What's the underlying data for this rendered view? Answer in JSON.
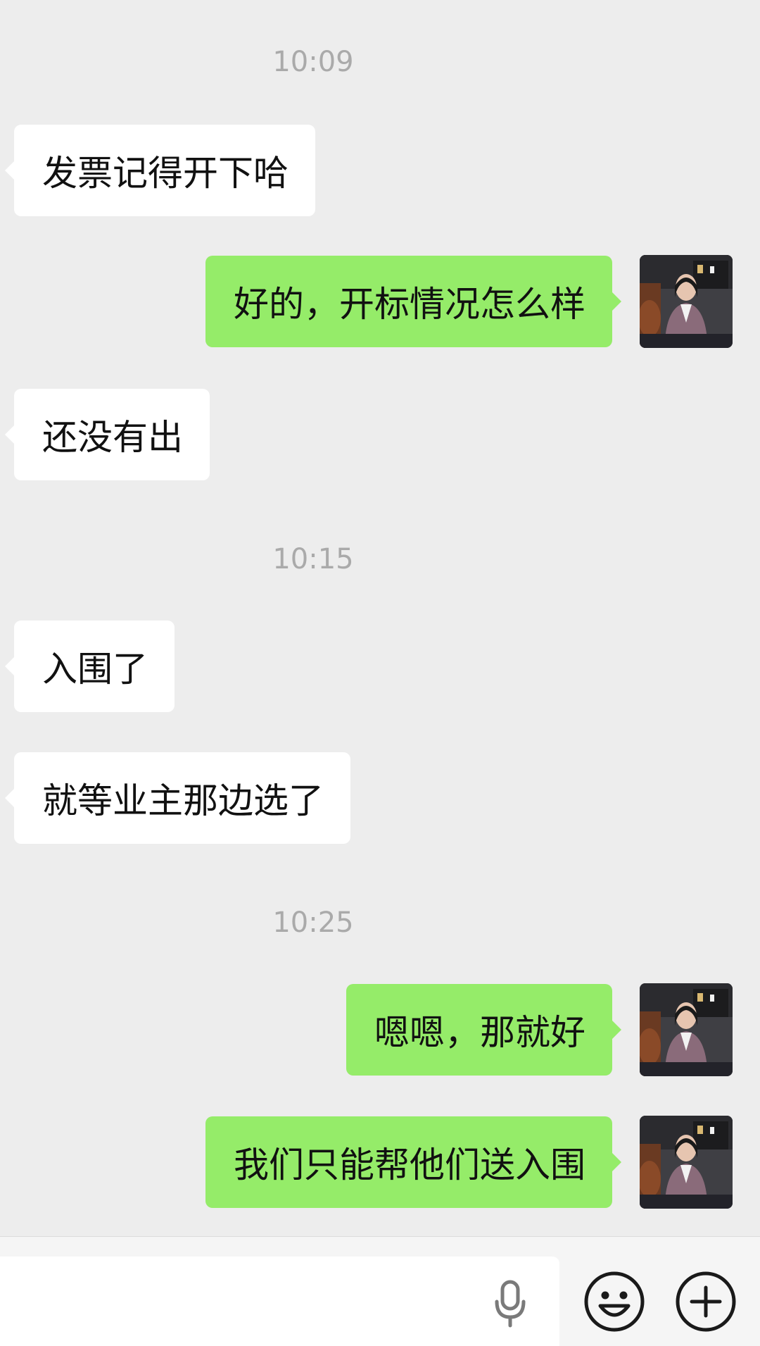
{
  "chat": {
    "items": [
      {
        "type": "time",
        "text": "10:09"
      },
      {
        "type": "in",
        "text": "发票记得开下哈"
      },
      {
        "type": "out",
        "text": "好的，开标情况怎么样"
      },
      {
        "type": "in",
        "text": "还没有出"
      },
      {
        "type": "time",
        "text": "10:15"
      },
      {
        "type": "in",
        "text": "入围了"
      },
      {
        "type": "in",
        "text": "就等业主那边选了"
      },
      {
        "type": "time",
        "text": "10:25"
      },
      {
        "type": "out",
        "text": "嗯嗯，那就好"
      },
      {
        "type": "out",
        "text": "我们只能帮他们送入围"
      }
    ]
  },
  "input_bar": {
    "text": "",
    "icons": [
      "mic-icon",
      "emoji-icon",
      "plus-icon"
    ]
  },
  "colors": {
    "background": "#ededed",
    "incoming_bubble": "#ffffff",
    "outgoing_bubble": "#95ec69",
    "timestamp": "#aaaaaa"
  }
}
